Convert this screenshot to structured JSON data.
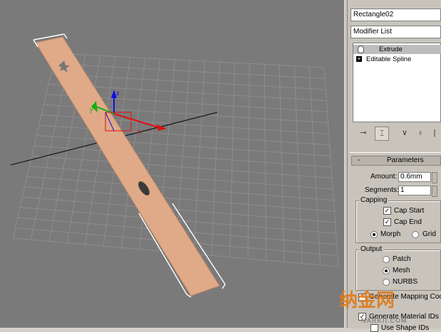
{
  "viewport": {
    "bg_color": "#7a7a7a",
    "grid_color": "#8e8e8e",
    "object_color": "#e0aa88"
  },
  "panel": {
    "object_name": "Rectangle02",
    "modifier_list_label": "Modifier List",
    "stack_items": [
      {
        "label": "Extrude",
        "selected": true,
        "icon": "bulb-icon"
      },
      {
        "label": "Editable Spline",
        "selected": false,
        "icon": "plus-box-icon"
      }
    ],
    "toolbar_icons": [
      "pin-stack-icon",
      "show-end-result-icon",
      "make-unique-icon",
      "remove-modifier-icon",
      "configure-sets-icon"
    ]
  },
  "parameters": {
    "title": "Parameters",
    "collapse_symbol": "-",
    "amount_label": "Amount:",
    "amount_value": "0.6mm",
    "segments_label": "Segments:",
    "segments_value": "1",
    "capping": {
      "title": "Capping",
      "cap_start": "Cap Start",
      "cap_start_checked": true,
      "cap_end": "Cap End",
      "cap_end_checked": true,
      "morph": "Morph",
      "grid": "Grid",
      "selected": "Morph"
    },
    "output": {
      "title": "Output",
      "patch": "Patch",
      "mesh": "Mesh",
      "nurbs": "NURBS",
      "selected": "Mesh"
    },
    "gen_mapping": "Generate Mapping Coords.",
    "gen_material_ids": "Generate Material IDs",
    "use_shape_ids": "Use Shape IDs"
  },
  "watermark": {
    "text": "NARKII.COM",
    "logo": "纳金网"
  }
}
